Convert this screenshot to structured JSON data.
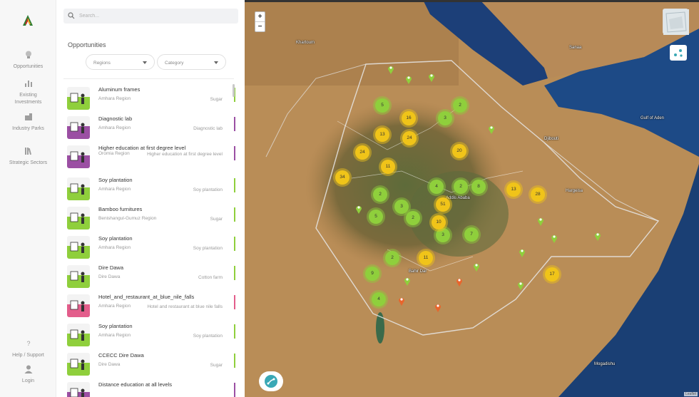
{
  "colors": {
    "accent_green": "#8fcf3c",
    "accent_yellow": "#f0c419",
    "accent_purple": "#9b4fa3",
    "accent_pink": "#e35d8b",
    "pin_orange": "#e8652c",
    "fab_teal": "#3aa8b5"
  },
  "rail": {
    "logo_icon": "app-logo-icon",
    "items": [
      {
        "label": "Opportunities",
        "icon": "lightbulb-icon"
      },
      {
        "label": "Existing Investments",
        "icon": "bar-chart-icon"
      },
      {
        "label": "Industry Parks",
        "icon": "building-icon"
      },
      {
        "label": "Strategic Sectors",
        "icon": "books-icon"
      }
    ],
    "help_label": "Help / Support",
    "login_label": "Login"
  },
  "search": {
    "placeholder": "Search..."
  },
  "panel": {
    "title": "Opportunities",
    "filters": {
      "regions": "Regions",
      "category": "Category"
    },
    "items": [
      {
        "title": "Aluminum frames",
        "region": "Amhara Region",
        "category": "Sugar",
        "color": "#8fcf3c"
      },
      {
        "title": "Diagnostic lab",
        "region": "Amhara Region",
        "category": "Diagnostic lab",
        "color": "#9b4fa3"
      },
      {
        "title": "Higher education at first degree level",
        "region": "Oromia Region",
        "category": "Higher education at first degree level",
        "color": "#9b4fa3"
      },
      {
        "title": "Soy plantation",
        "region": "Amhara Region",
        "category": "Soy plantation",
        "color": "#8fcf3c"
      },
      {
        "title": "Bamboo furnitures",
        "region": "Benishangul-Gumuz Region",
        "category": "Sugar",
        "color": "#8fcf3c"
      },
      {
        "title": "Soy plantation",
        "region": "Amhara Region",
        "category": "Soy plantation",
        "color": "#8fcf3c"
      },
      {
        "title": "Dire Dawa",
        "region": "Dire Dawa",
        "category": "Cotton farm",
        "color": "#8fcf3c"
      },
      {
        "title": "Hotel_and_restaurant_at_blue_nile_falls",
        "region": "Amhara Region",
        "category": "Hotel and restaurant at blue nile falls",
        "color": "#e35d8b"
      },
      {
        "title": "Soy plantation",
        "region": "Amhara Region",
        "category": "Soy plantation",
        "color": "#8fcf3c"
      },
      {
        "title": "CCECC Dire Dawa",
        "region": "Dire Dawa",
        "category": "Sugar",
        "color": "#8fcf3c"
      },
      {
        "title": "Distance education at all levels",
        "region": "",
        "category": "",
        "color": "#9b4fa3"
      }
    ]
  },
  "map": {
    "zoom_in": "+",
    "zoom_out": "−",
    "attribution": "Leaflet",
    "labels": [
      "Khartoum",
      "Sanaa",
      "Addis Ababa",
      "Mogadishu",
      "Gulf of Aden",
      "Djibouti",
      "Hargeisa",
      "Bahir Dar"
    ],
    "green_clusters": [
      "2",
      "5",
      "3",
      "2",
      "4",
      "7",
      "2",
      "3",
      "2",
      "9",
      "4",
      "2",
      "3",
      "5",
      "8"
    ],
    "yellow_clusters": [
      "16",
      "13",
      "24",
      "24",
      "11",
      "34",
      "20",
      "13",
      "28",
      "51",
      "10",
      "11",
      "17"
    ]
  }
}
